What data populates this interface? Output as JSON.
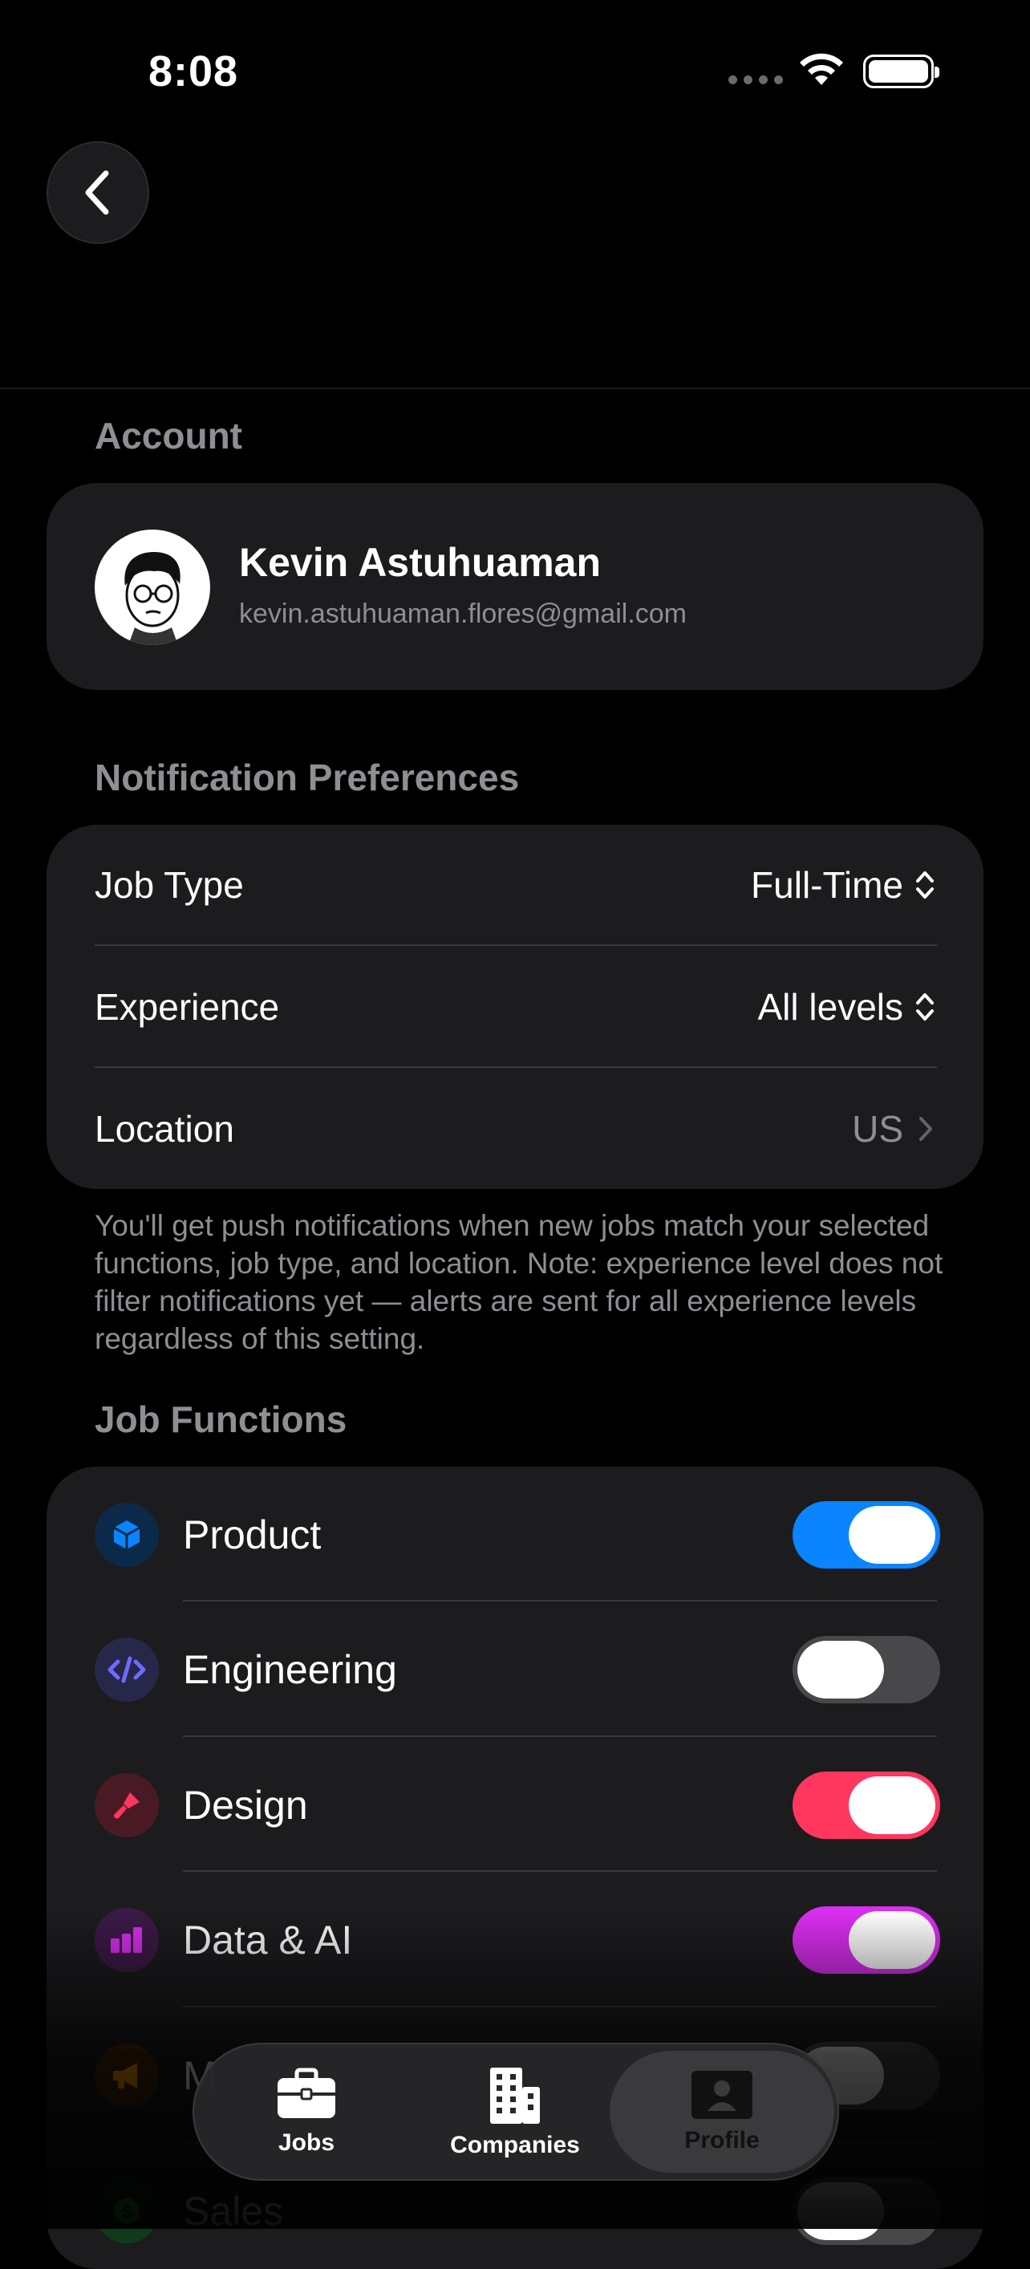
{
  "status_bar": {
    "time": "8:08"
  },
  "account": {
    "section_title": "Account",
    "name": "Kevin Astuhuaman",
    "email": "kevin.astuhuaman.flores@gmail.com"
  },
  "notifications": {
    "section_title": "Notification Preferences",
    "rows": [
      {
        "label": "Job Type",
        "value": "Full-Time"
      },
      {
        "label": "Experience",
        "value": "All levels"
      },
      {
        "label": "Location",
        "value": "US"
      }
    ],
    "note": "You'll get push notifications when new jobs match your selected functions, job type, and location. Note: experience level does not filter notifications yet — alerts are sent for all experience levels regardless of this setting."
  },
  "job_functions": {
    "section_title": "Job Functions",
    "items": [
      {
        "label": "Product",
        "icon": "cube-icon",
        "on": true,
        "color": "#0a84ff"
      },
      {
        "label": "Engineering",
        "icon": "code-icon",
        "on": false,
        "color": "#5e5ce6"
      },
      {
        "label": "Design",
        "icon": "brush-icon",
        "on": true,
        "color": "#ff375f"
      },
      {
        "label": "Data & AI",
        "icon": "bar-chart-icon",
        "on": true,
        "color": "#da2ff0"
      },
      {
        "label": "M",
        "icon": "megaphone-icon",
        "on": false,
        "color": "#ff9f0a"
      },
      {
        "label": "Sales",
        "icon": "dollar-icon",
        "on": false,
        "color": "#30d158"
      }
    ]
  },
  "tab_bar": {
    "tabs": [
      {
        "label": "Jobs",
        "icon": "briefcase-icon"
      },
      {
        "label": "Companies",
        "icon": "building-icon"
      },
      {
        "label": "Profile",
        "icon": "person-icon",
        "active": true
      }
    ]
  }
}
